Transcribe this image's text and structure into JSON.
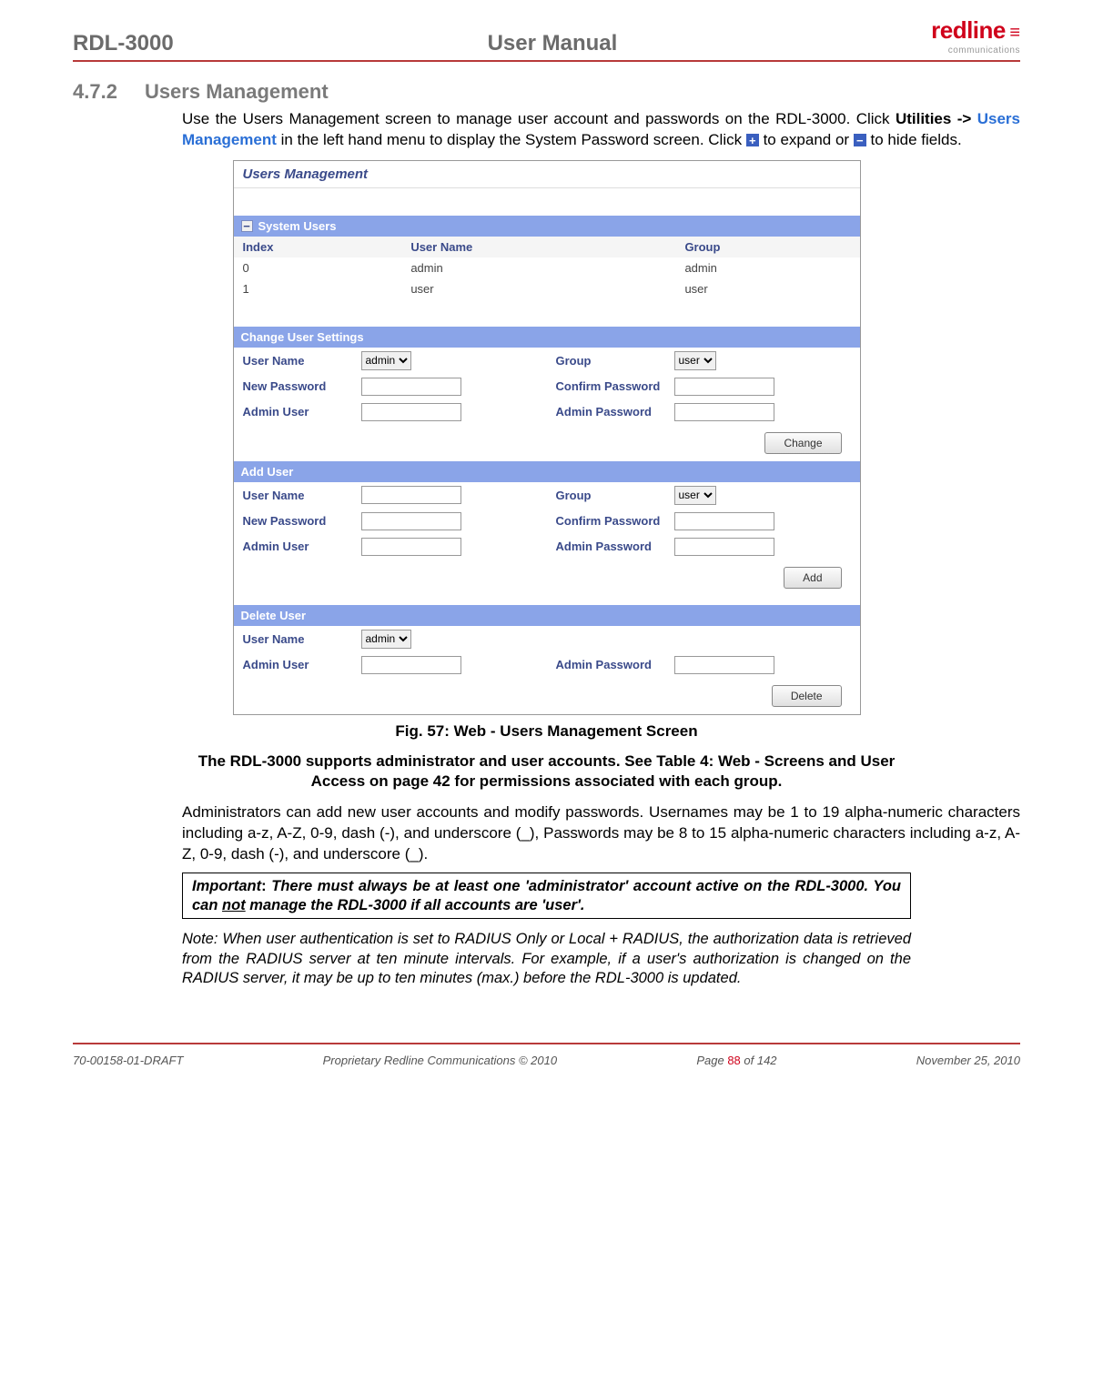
{
  "header": {
    "left": "RDL-3000",
    "center": "User Manual",
    "logo_main": "redline",
    "logo_sub": "communications"
  },
  "section": {
    "number": "4.7.2",
    "title": "Users Management"
  },
  "intro": {
    "l1a": "Use the Users Management  screen to manage user account and passwords on the RDL-3000. Click ",
    "l1b": "Utilities -> ",
    "l1c": "Users Management",
    "l1d": " in the left hand menu to display the System Password screen. Click ",
    "l1e": " to expand or ",
    "l1f": " to hide fields."
  },
  "screenshot": {
    "title": "Users Management",
    "system_users": {
      "header": "System Users",
      "cols": [
        "Index",
        "User Name",
        "Group"
      ],
      "rows": [
        [
          "0",
          "admin",
          "admin"
        ],
        [
          "1",
          "user",
          "user"
        ]
      ]
    },
    "change_user": {
      "header": "Change User Settings",
      "user_name": "User Name",
      "group": "Group",
      "new_password": "New Password",
      "confirm_password": "Confirm Password",
      "admin_user": "Admin User",
      "admin_password": "Admin Password",
      "sel_un": "admin",
      "sel_group": "user",
      "button": "Change"
    },
    "add_user": {
      "header": "Add User",
      "user_name": "User Name",
      "group": "Group",
      "new_password": "New Password",
      "confirm_password": "Confirm Password",
      "admin_user": "Admin User",
      "admin_password": "Admin Password",
      "sel_group": "user",
      "button": "Add"
    },
    "delete_user": {
      "header": "Delete User",
      "user_name": "User Name",
      "admin_user": "Admin User",
      "admin_password": "Admin Password",
      "sel_un": "admin",
      "button": "Delete"
    }
  },
  "figure_caption": "Fig. 57: Web - Users Management Screen",
  "bold_paragraph": "The RDL-3000 supports administrator and user accounts. See Table 4: Web - Screens and User Access on page 42 for permissions associated with each group.",
  "admin_paragraph": "Administrators can add new user accounts and modify passwords. Usernames may be 1 to 19 alpha-numeric characters including a-z, A-Z, 0-9, dash (-), and underscore (_), Passwords may be 8 to 15 alpha-numeric characters including a-z, A-Z, 0-9, dash (-), and underscore (_).",
  "important": {
    "label": "Important",
    "colon": ": ",
    "text1": "There must always be at least one 'administrator' account active on the RDL-3000. You can ",
    "not": "not",
    "text2": " manage the RDL-3000 if all accounts are 'user'."
  },
  "note": "Note: When user authentication is set to RADIUS Only or Local + RADIUS, the authorization data is retrieved from the RADIUS server at ten minute intervals. For example, if a user's authorization is changed on the RADIUS server, it may be up to ten minutes (max.) before the RDL-3000 is updated.",
  "footer": {
    "left": "70-00158-01-DRAFT",
    "center": "Proprietary Redline Communications © 2010",
    "page_a": "Page ",
    "page_n": "88",
    "page_b": " of 142",
    "right": "November 25, 2010"
  }
}
